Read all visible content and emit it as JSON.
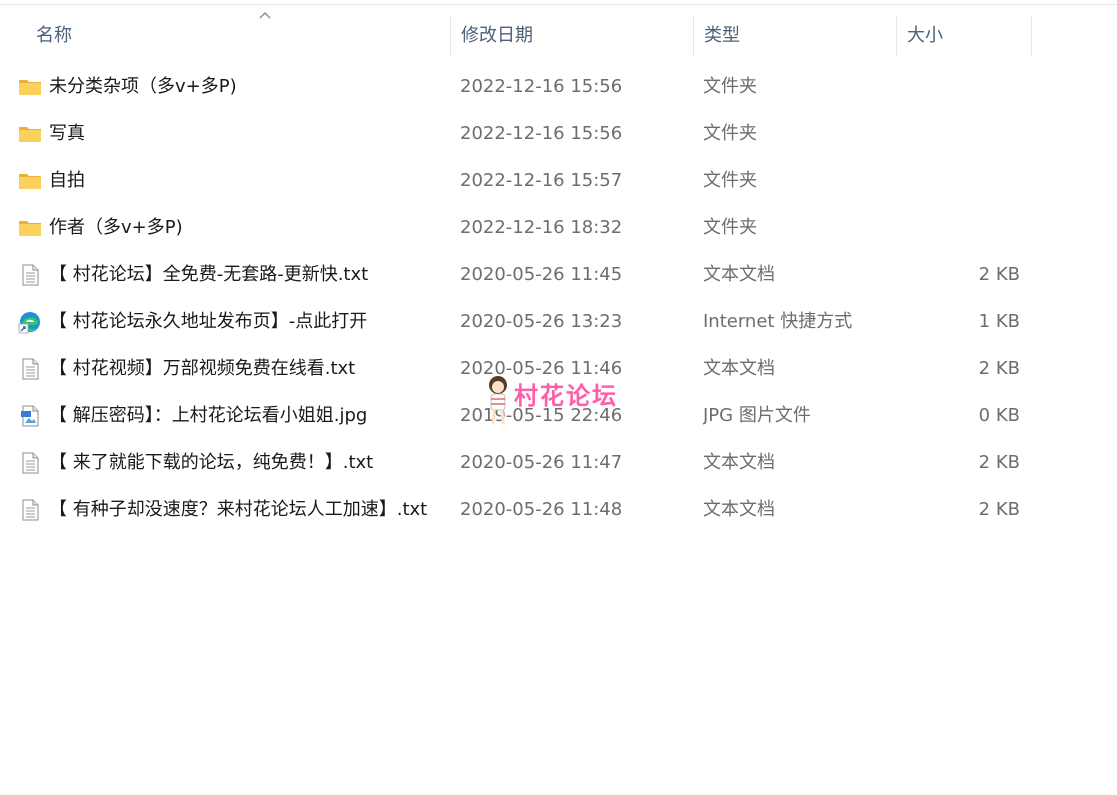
{
  "columns": {
    "name": "名称",
    "date": "修改日期",
    "type": "类型",
    "size": "大小"
  },
  "files": [
    {
      "name": "未分类杂项（多v+多P)",
      "date": "2022-12-16 15:56",
      "type": "文件夹",
      "size": "",
      "icon": "folder-icon"
    },
    {
      "name": "写真",
      "date": "2022-12-16 15:56",
      "type": "文件夹",
      "size": "",
      "icon": "folder-icon"
    },
    {
      "name": "自拍",
      "date": "2022-12-16 15:57",
      "type": "文件夹",
      "size": "",
      "icon": "folder-icon"
    },
    {
      "name": "作者（多v+多P)",
      "date": "2022-12-16 18:32",
      "type": "文件夹",
      "size": "",
      "icon": "folder-icon"
    },
    {
      "name": "【 村花论坛】全免费-无套路-更新快.txt",
      "date": "2020-05-26 11:45",
      "type": "文本文档",
      "size": "2 KB",
      "icon": "text-document-icon"
    },
    {
      "name": "【 村花论坛永久地址发布页】-点此打开",
      "date": "2020-05-26 13:23",
      "type": "Internet 快捷方式",
      "size": "1 KB",
      "icon": "edge-browser-icon"
    },
    {
      "name": "【 村花视频】万部视频免费在线看.txt",
      "date": "2020-05-26 11:46",
      "type": "文本文档",
      "size": "2 KB",
      "icon": "text-document-icon"
    },
    {
      "name": "【 解压密码】：上村花论坛看小姐姐.jpg",
      "date": "2019-05-15 22:46",
      "type": "JPG 图片文件",
      "size": "0 KB",
      "icon": "image-file-icon"
    },
    {
      "name": "【 来了就能下载的论坛，纯免费！】.txt",
      "date": "2020-05-26 11:47",
      "type": "文本文档",
      "size": "2 KB",
      "icon": "text-document-icon"
    },
    {
      "name": "【 有种子却没速度？来村花论坛人工加速】.txt",
      "date": "2020-05-26 11:48",
      "type": "文本文档",
      "size": "2 KB",
      "icon": "text-document-icon"
    }
  ],
  "watermark": {
    "text": "村花论坛"
  },
  "colors": {
    "header_text": "#4c607a",
    "folder": "#f7c948",
    "watermark": "#ff5fa8"
  }
}
